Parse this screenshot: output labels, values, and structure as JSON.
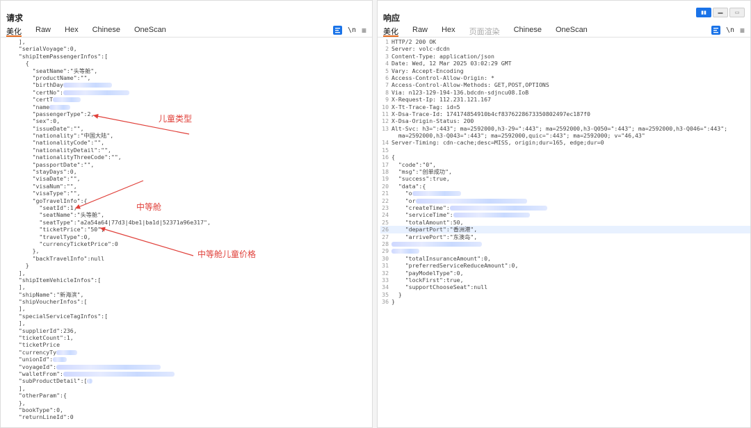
{
  "request": {
    "title": "请求",
    "tabs": [
      "美化",
      "Raw",
      "Hex",
      "Chinese",
      "OneScan"
    ],
    "icons": {
      "format": "format-icon",
      "newline": "\\n",
      "menu": "≡"
    },
    "lines": [
      "  ],",
      "  \"serialVoyage\":0,",
      "  \"shipItemPassengerInfos\":[",
      "    {",
      "      \"seatName\":\"头等舱\",",
      "      \"productName\":\"\",",
      "      \"birthDay",
      "      \"certNo\":",
      "      \"certT",
      "      \"name",
      "      \"passengerType\":2,",
      "      \"sex\":0,",
      "      \"issueDate\":\"\",",
      "      \"nationality\":\"中国大陆\",",
      "      \"nationalityCode\":\"\",",
      "      \"nationalityDetail\":\"\",",
      "      \"nationalityThreeCode\":\"\",",
      "      \"passportDate\":\"\",",
      "      \"stayDays\":0,",
      "      \"visaDate\":\"\",",
      "      \"visaNum\":\"\",",
      "      \"visaType\":\"\",",
      "      \"goTravelInfo\":{",
      "        \"seatId\":1,",
      "        \"seatName\":\"头等舱\",",
      "        \"seatType\":\"a2a54a64|77d3|4be1|ba1d|52371a96e317\",",
      "        \"ticketPrice\":\"50\",",
      "        \"travelType\":0,",
      "        \"currencyTicketPrice\":0",
      "      },",
      "      \"backTravelInfo\":null",
      "    }",
      "  ],",
      "  \"shipItemVehicleInfos\":[",
      "  ],",
      "  \"shipName\":\"新海滨\",",
      "  \"shipVoucherInfos\":[",
      "  ],",
      "  \"specialServiceTagInfos\":[",
      "  ],",
      "  \"supplierId\":236,",
      "  \"ticketCount\":1,",
      "  \"ticketPrice",
      "  \"currencyTy",
      "  \"unionId\":",
      "  \"voyageId\":",
      "  \"walletFrom\":",
      "  \"subProductDetail\":[",
      "  ],",
      "  \"otherParam\":{",
      "  },",
      "  \"bookType\":0,",
      "  \"returnLineId\":0"
    ]
  },
  "response": {
    "title": "响应",
    "tabs": [
      "美化",
      "Raw",
      "Hex",
      "页面渲染",
      "Chinese",
      "OneScan"
    ],
    "icons": {
      "format": "format-icon",
      "newline": "\\n",
      "menu": "≡"
    },
    "lines": [
      "HTTP/2 200 OK",
      "Server: volc-dcdn",
      "Content-Type: application/json",
      "Date: Wed, 12 Mar 2025 03:02:29 GMT",
      "Vary: Accept-Encoding",
      "Access-Control-Allow-Origin: *",
      "Access-Control-Allow-Methods: GET,POST,OPTIONS",
      "Via: n123-129-194-136.bdcdn-sdjncu08.IoB",
      "X-Request-Ip: 112.231.121.167",
      "X-Tt-Trace-Tag: id=5",
      "X-Dsa-Trace-Id: 174174854910b4cf8376228673350802497ec187f0",
      "X-Dsa-Origin-Status: 200",
      "Alt-Svc: h3=\":443\"; ma=2592000,h3-29=\":443\"; ma=2592000,h3-Q050=\":443\"; ma=2592000,h3-Q046=\":443\";",
      "  ma=2592000,h3-Q043=\":443\"; ma=2592000,quic=\":443\"; ma=2592000; v=\"46,43\"",
      "Server-Timing: cdn-cache;desc=MISS, origin;dur=165, edge;dur=0",
      "",
      "{",
      "  \"code\":\"0\",",
      "  \"msg\":\"创单成功\",",
      "  \"success\":true,",
      "  \"data\":{",
      "    \"o",
      "    \"or",
      "    \"createTime\":",
      "    \"serviceTime\":",
      "    \"totalAmount\":50,",
      "    \"departPort\":\"香洲港\",",
      "    \"arrivePort\":\"东澳岛\",",
      "",
      "",
      "    \"totalInsuranceAmount\":0,",
      "    \"preferredServiceReduceAmount\":0,",
      "    \"payModelType\":0,",
      "    \"lockFirst\":true,",
      "    \"supportChooseSeat\":null",
      "  }",
      "}"
    ],
    "line_numbers": [
      "1",
      "2",
      "3",
      "4",
      "5",
      "6",
      "7",
      "8",
      "9",
      "10",
      "11",
      "12",
      "13",
      "",
      "14",
      "15",
      "16",
      "17",
      "18",
      "19",
      "20",
      "21",
      "22",
      "23",
      "24",
      "25",
      "26",
      "27",
      "28",
      "29",
      "30",
      "31",
      "32",
      "33",
      "34",
      "35",
      "36"
    ]
  },
  "annotations": {
    "child_type": "儿童类型",
    "mid_class": "中等舱",
    "mid_class_child_price": "中等舱儿童价格"
  },
  "colors": {
    "annotation": "#e0403a",
    "accent": "#1a73e8",
    "tab_active": "#e56a1e"
  }
}
